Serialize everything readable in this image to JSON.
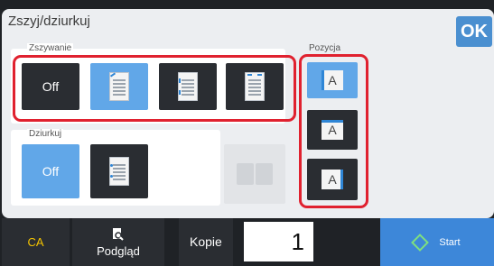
{
  "header": {
    "title": "Zszyj/dziurkuj",
    "ok_label": "OK"
  },
  "zszywanie": {
    "label": "Zszywanie",
    "off_label": "Off",
    "options": [
      "off",
      "corner-staple",
      "left-two-staples",
      "right-two-staples"
    ],
    "selected": "corner-staple"
  },
  "dziurkuj": {
    "label": "Dziurkuj",
    "off_label": "Off",
    "selected": "off"
  },
  "pozycja": {
    "label": "Pozycja",
    "glyph": "A",
    "options": [
      "left",
      "top",
      "right"
    ],
    "selected": "left"
  },
  "bottom": {
    "ca_label": "CA",
    "preview_label": "Podgląd",
    "copies_label": "Kopie",
    "copies_value": "1",
    "start_label": "Start"
  },
  "colors": {
    "accent": "#61a7e8",
    "highlight": "#e0212f",
    "ca": "#f5c400",
    "start": "#3d87d9"
  }
}
